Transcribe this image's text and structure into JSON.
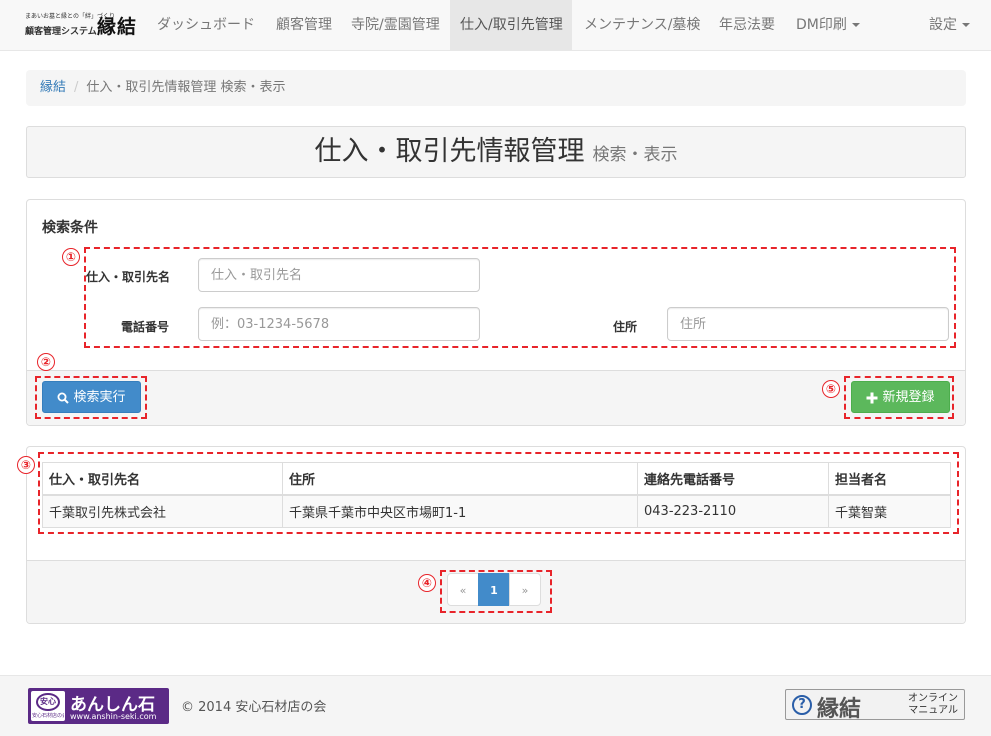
{
  "brand": {
    "tagline": "まあいお墓と縁との「絆」づくり",
    "system_name": "顧客管理システム",
    "logo": "縁結"
  },
  "nav": {
    "items": [
      {
        "label": "ダッシュボード"
      },
      {
        "label": "顧客管理"
      },
      {
        "label": "寺院/霊園管理"
      },
      {
        "label": "仕入/取引先管理",
        "active": true
      },
      {
        "label": "メンテナンス/墓検"
      },
      {
        "label": "年忌法要"
      },
      {
        "label": "DM印刷"
      }
    ],
    "settings_label": "設定"
  },
  "breadcrumb": {
    "home": "縁結",
    "separator": "/",
    "current": "仕入・取引先情報管理 検索・表示"
  },
  "page_header": {
    "title": "仕入・取引先情報管理",
    "subtitle": "検索・表示"
  },
  "search": {
    "heading": "検索条件",
    "fields": {
      "name": {
        "label": "仕入・取引先名",
        "placeholder": "仕入・取引先名",
        "value": ""
      },
      "phone": {
        "label": "電話番号",
        "placeholder": "例：03-1234-5678",
        "value": ""
      },
      "address": {
        "label": "住所",
        "placeholder": "住所",
        "value": ""
      }
    },
    "search_button": "検索実行",
    "new_button": "新規登録"
  },
  "annotations": [
    "①",
    "②",
    "③",
    "④",
    "⑤"
  ],
  "annotation_color": "#e8242a",
  "results": {
    "columns": [
      "仕入・取引先名",
      "住所",
      "連絡先電話番号",
      "担当者名"
    ],
    "rows": [
      [
        "千葉取引先株式会社",
        "千葉県千葉市中央区市場町1-1",
        "043-223-2110",
        "千葉智葉"
      ]
    ]
  },
  "pagination": {
    "prev": "«",
    "pages": [
      "1"
    ],
    "current": "1",
    "next": "»"
  },
  "footer": {
    "logo_badge": "安心",
    "logo_badge_sub": "安心石材店の会",
    "logo_name": "あんしん石",
    "logo_url": "www.anshin-seki.com",
    "copyright": "© 2014 安心石材店の会",
    "manual_logo": "縁結",
    "manual_text": "オンライン\nマニュアル",
    "manual_icon": "?"
  },
  "colors": {
    "primary": "#428bca",
    "success": "#5cb85c",
    "brand_purple": "#5b2a86"
  }
}
